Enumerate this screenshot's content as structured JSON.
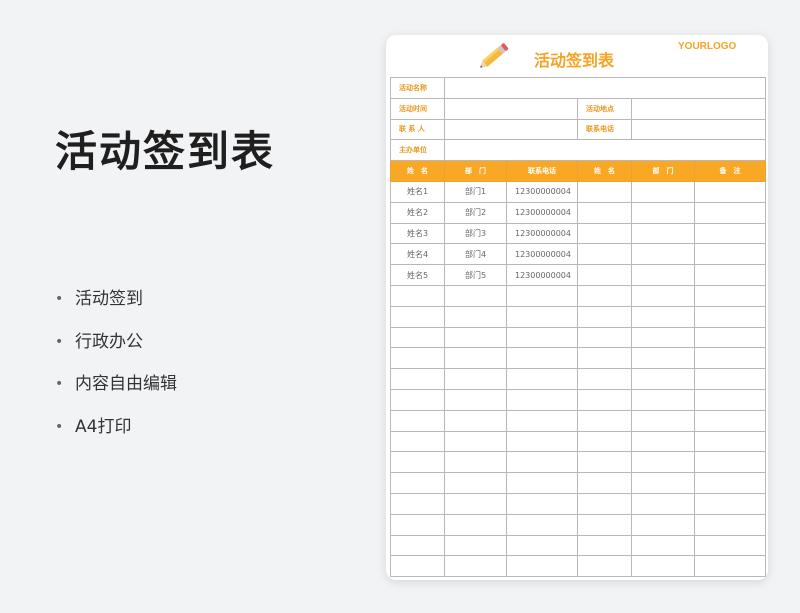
{
  "main": {
    "title": "活动签到表",
    "features": [
      "活动签到",
      "行政办公",
      "内容自由编辑",
      "A4打印"
    ]
  },
  "sheet": {
    "title": "活动签到表",
    "logo": "YOURLOGO",
    "labels": {
      "activity_name": "活动名称",
      "activity_time": "活动时间",
      "activity_place": "活动地点",
      "contact": "联 系 人",
      "contact_phone": "联系电话",
      "organizer": "主办单位"
    },
    "columns": [
      "姓　名",
      "部　门",
      "联系电话",
      "姓　名",
      "部　门",
      "备　注"
    ],
    "rows": [
      {
        "name": "姓名1",
        "dept": "部门1",
        "phone": "12300000004"
      },
      {
        "name": "姓名2",
        "dept": "部门2",
        "phone": "12300000004"
      },
      {
        "name": "姓名3",
        "dept": "部门3",
        "phone": "12300000004"
      },
      {
        "name": "姓名4",
        "dept": "部门4",
        "phone": "12300000004"
      },
      {
        "name": "姓名5",
        "dept": "部门5",
        "phone": "12300000004"
      }
    ],
    "empty_row_count": 14
  },
  "colors": {
    "accent": "#f9a826",
    "text_dark": "#1f1f1f",
    "border": "#b8b8b8"
  },
  "icons": {
    "header": "pencil-icon"
  }
}
